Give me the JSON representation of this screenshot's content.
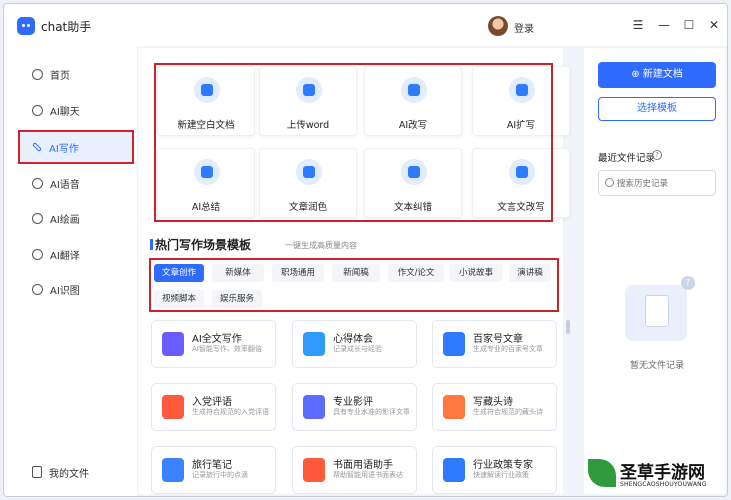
{
  "app": {
    "title": "chat助手",
    "login": "登录"
  },
  "window": {
    "menu": "☰",
    "minimize": "—",
    "maximize": "☐",
    "close": "✕"
  },
  "sidebar": {
    "items": [
      {
        "label": "首页",
        "icon": "home-icon"
      },
      {
        "label": "AI聊天",
        "icon": "chat-icon"
      },
      {
        "label": "AI写作",
        "icon": "pen-icon"
      },
      {
        "label": "AI语音",
        "icon": "voice-icon"
      },
      {
        "label": "AI绘画",
        "icon": "palette-icon"
      },
      {
        "label": "AI翻译",
        "icon": "translate-icon"
      },
      {
        "label": "AI识图",
        "icon": "image-recognition-icon"
      }
    ],
    "files": "我的文件"
  },
  "tools": [
    "新建空白文档",
    "上传word",
    "AI改写",
    "AI扩写",
    "AI总结",
    "文章润色",
    "文本纠错",
    "文言文改写"
  ],
  "section": {
    "title": "热门写作场景模板",
    "subtitle": "一键生成高质量内容"
  },
  "tags": [
    "文章创作",
    "新媒体",
    "职场通用",
    "新闻稿",
    "作文/论文",
    "小说故事",
    "演讲稿",
    "视频脚本",
    "娱乐服务"
  ],
  "templates": [
    {
      "title": "AI全文写作",
      "desc": "AI智能写作、效率翻倍",
      "color": "#6b5cff"
    },
    {
      "title": "心得体会",
      "desc": "记录成长与经验",
      "color": "#2f9bff"
    },
    {
      "title": "百家号文章",
      "desc": "生成专业的百家号文章",
      "color": "#2f7bff"
    },
    {
      "title": "入党评语",
      "desc": "生成符合规范的入党评语",
      "color": "#ff5a3c"
    },
    {
      "title": "专业影评",
      "desc": "具有专业水准的影评文章",
      "color": "#5b6cff"
    },
    {
      "title": "写藏头诗",
      "desc": "生成符合规范的藏头诗",
      "color": "#ff7a3c"
    },
    {
      "title": "旅行笔记",
      "desc": "记录旅行中的点滴",
      "color": "#3b82ff"
    },
    {
      "title": "书面用语助手",
      "desc": "帮助智能用语书面表达",
      "color": "#ff5a3c"
    },
    {
      "title": "行业政策专家",
      "desc": "快速解读行业政策",
      "color": "#2f7bff"
    }
  ],
  "right": {
    "new_doc": "⊕ 新建文档",
    "pick_template": "选择模板",
    "recent": "最近文件记录",
    "help": "?",
    "search_placeholder": "搜索历史记录",
    "empty": "暂无文件记录"
  },
  "watermark": {
    "title": "圣草手游网",
    "site": "SHENGCAOSHOUYOUWANG"
  },
  "colors": {
    "accent": "#2f6bff",
    "highlight": "#c8242c"
  }
}
